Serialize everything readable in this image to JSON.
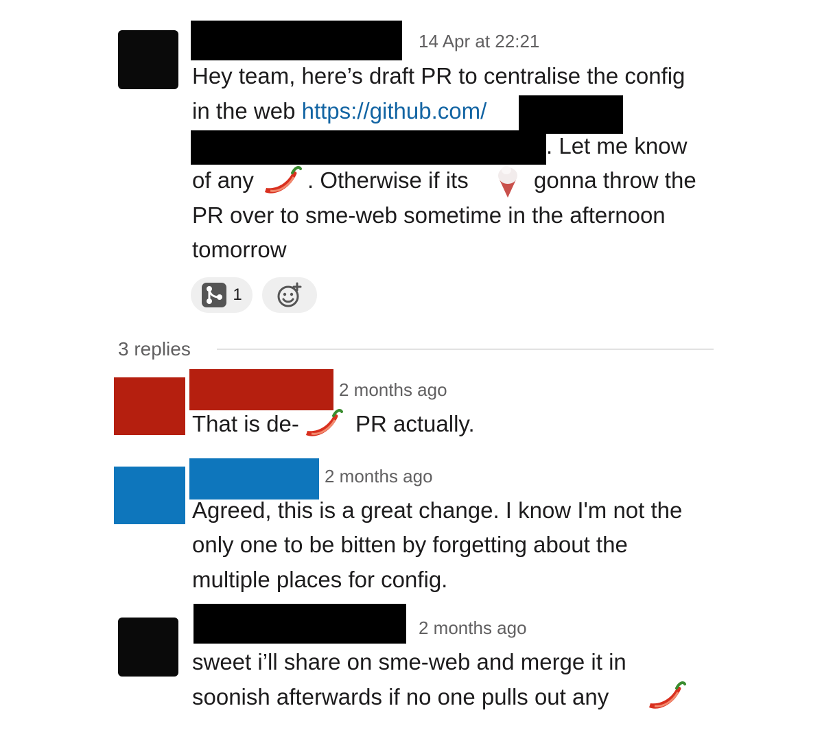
{
  "thread": {
    "parent": {
      "timestamp": "14 Apr at 22:21",
      "text": {
        "l1": "Hey team, here’s draft PR to centralise the config",
        "l2a": "in the web ",
        "l2_link": "https://github.com/",
        "l3": ". Let me know",
        "l4a": "of any",
        "l4b": ". Otherwise if its",
        "l4c": "gonna throw the",
        "l5": "PR over to sme-web sometime in the afternoon",
        "l6": "tomorrow"
      },
      "reactions": [
        {
          "icon": "git-merge-icon",
          "count": "1"
        }
      ],
      "add_reaction_icon": "add-reaction-icon"
    },
    "replies_label": "3 replies",
    "replies": [
      {
        "timestamp": "2 months ago",
        "avatar_color": "#b51f0f",
        "name_color": "#b51f0f",
        "text": {
          "a": "That is de-",
          "b": "PR actually."
        }
      },
      {
        "timestamp": "2 months ago",
        "avatar_color": "#0e76bc",
        "name_color": "#0e76bc",
        "text": {
          "l1": "Agreed, this is a great change. I know I'm not the",
          "l2": "only one to be bitten by forgetting about the",
          "l3": "multiple places for config."
        }
      },
      {
        "timestamp": "2 months ago",
        "text": {
          "l1": "sweet i’ll share on sme-web and merge it in",
          "l2": "soonish afterwards if no one pulls out any"
        }
      }
    ]
  }
}
